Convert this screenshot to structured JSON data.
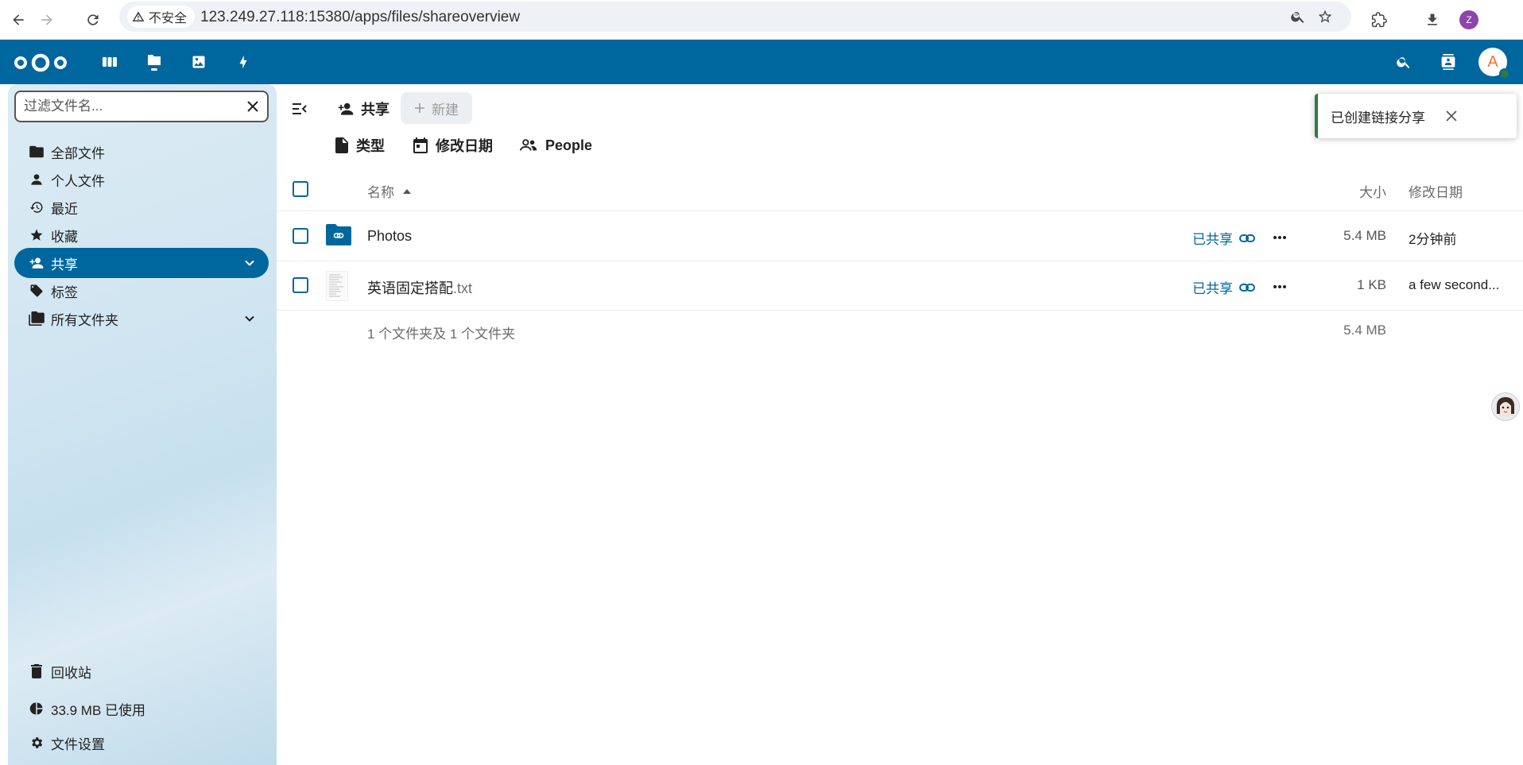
{
  "browser": {
    "security_label": "不安全",
    "url": "123.249.27.118:15380/apps/files/shareoverview",
    "profile_initial": "Z",
    "profile_color": "#8e44ad"
  },
  "header": {
    "avatar_initial": "A",
    "brand_color": "#00679e",
    "apps": [
      "dashboard-icon",
      "files-icon",
      "photos-icon",
      "activity-icon"
    ]
  },
  "sidebar": {
    "filter_placeholder": "过滤文件名...",
    "items": [
      {
        "label": "全部文件",
        "icon": "folder-icon"
      },
      {
        "label": "个人文件",
        "icon": "account-icon"
      },
      {
        "label": "最近",
        "icon": "history-icon"
      },
      {
        "label": "收藏",
        "icon": "star-icon"
      },
      {
        "label": "共享",
        "icon": "share-icon",
        "active": true
      },
      {
        "label": "标签",
        "icon": "tag-icon"
      },
      {
        "label": "所有文件夹",
        "icon": "folder-multiple-icon"
      }
    ],
    "footer": {
      "trash": "回收站",
      "quota": "33.9 MB 已使用",
      "settings": "文件设置"
    }
  },
  "main": {
    "breadcrumb": "共享",
    "new_button": "新建",
    "filters": [
      "类型",
      "修改日期",
      "People"
    ],
    "columns": {
      "name": "名称",
      "size": "大小",
      "modified": "修改日期"
    },
    "rows": [
      {
        "name": "Photos",
        "ext": "",
        "shared": "已共享",
        "size": "5.4 MB",
        "modified": "2分钟前",
        "type": "folder"
      },
      {
        "name": "英语固定搭配",
        "ext": ".txt",
        "shared": "已共享",
        "size": "1 KB",
        "modified": "a few second...",
        "type": "text"
      }
    ],
    "summary": "1 个文件夹及 1 个文件夹",
    "summary_size": "5.4 MB"
  },
  "toast": {
    "message": "已创建链接分享",
    "color": "#2d7b41"
  }
}
